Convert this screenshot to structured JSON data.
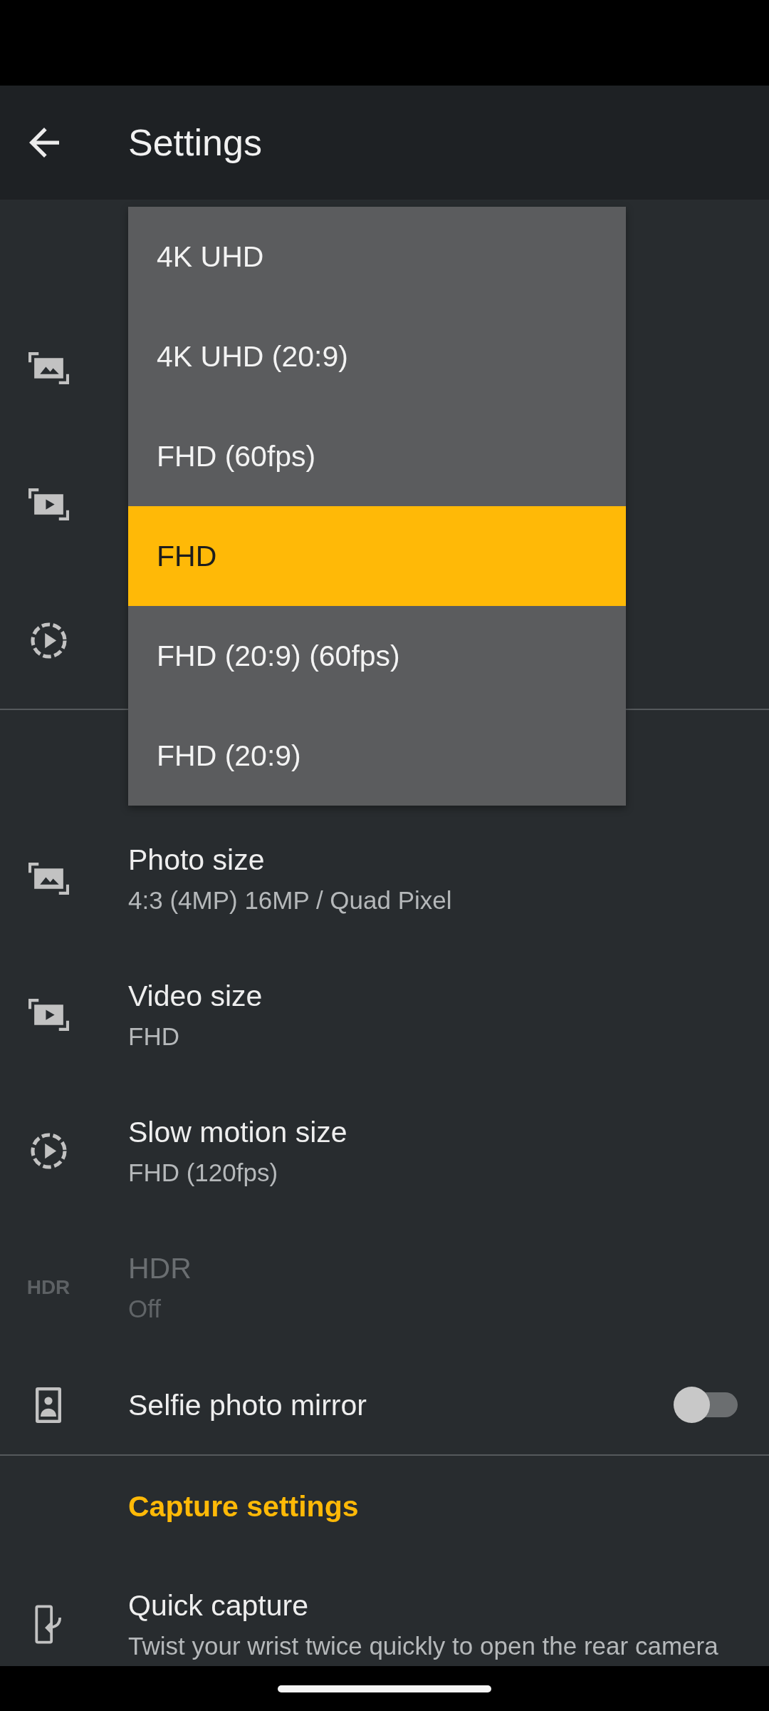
{
  "app_bar": {
    "title": "Settings"
  },
  "settings_groups": [
    {
      "rows": [
        {
          "kind": "photo",
          "disabled": false
        },
        {
          "kind": "video",
          "disabled": false
        },
        {
          "kind": "slow-motion",
          "disabled": false
        }
      ]
    },
    {
      "rows": [
        {
          "kind": "photo",
          "title": "Photo size",
          "value": "4:3 (4MP) 16MP / Quad Pixel",
          "disabled": false
        },
        {
          "kind": "video",
          "title": "Video size",
          "value": "FHD",
          "disabled": false
        },
        {
          "kind": "slow-motion",
          "title": "Slow motion size",
          "value": "FHD (120fps)",
          "disabled": false
        },
        {
          "kind": "hdr",
          "icon_label": "HDR",
          "title": "HDR",
          "value": "Off",
          "disabled": true
        },
        {
          "kind": "selfie",
          "title": "Selfie photo mirror",
          "disabled": false,
          "toggle": {
            "on": false
          }
        }
      ]
    },
    {
      "header": "Capture settings",
      "rows": [
        {
          "kind": "quick-capture",
          "title": "Quick capture",
          "value": "Twist your wrist twice quickly to open the rear camera",
          "disabled": false
        }
      ]
    }
  ],
  "dropdown": {
    "options": [
      {
        "label": "4K UHD",
        "selected": false
      },
      {
        "label": "4K UHD (20:9)",
        "selected": false
      },
      {
        "label": "FHD (60fps)",
        "selected": false
      },
      {
        "label": "FHD",
        "selected": true
      },
      {
        "label": "FHD (20:9) (60fps)",
        "selected": false
      },
      {
        "label": "FHD (20:9)",
        "selected": false
      }
    ]
  }
}
